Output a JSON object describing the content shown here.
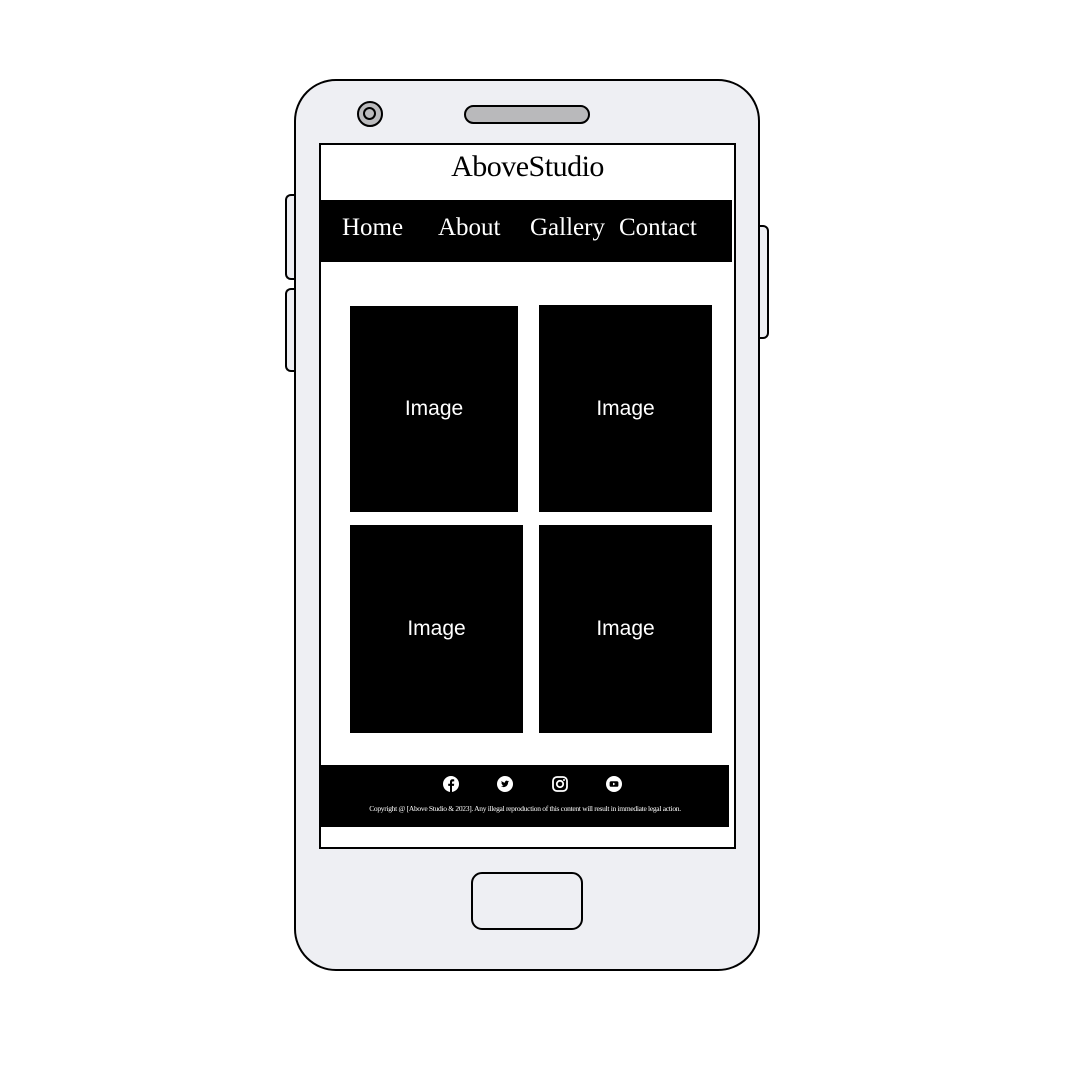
{
  "header": {
    "brand": "AboveStudio"
  },
  "nav": {
    "items": [
      {
        "label": "Home"
      },
      {
        "label": "About"
      },
      {
        "label": "Gallery"
      },
      {
        "label": "Contact"
      }
    ]
  },
  "gallery": {
    "tiles": [
      {
        "label": "Image"
      },
      {
        "label": "Image"
      },
      {
        "label": "Image"
      },
      {
        "label": "Image"
      }
    ]
  },
  "footer": {
    "social_icons": [
      "facebook-icon",
      "twitter-icon",
      "instagram-icon",
      "youtube-icon"
    ],
    "copyright": "Copyright @ [Above Studio & 2023]. Any illegal reproduction of this content will result in immediate legal action."
  },
  "colors": {
    "phone_body": "#eeeff3",
    "outline": "#000000",
    "screen": "#ffffff",
    "bars": "#000000",
    "bar_text": "#ffffff"
  }
}
